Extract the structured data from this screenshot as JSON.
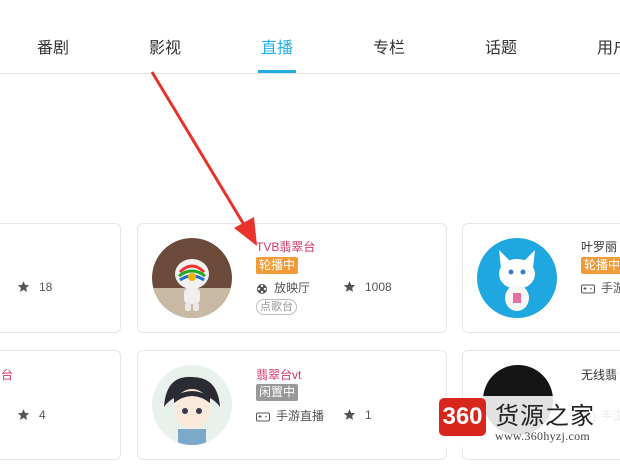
{
  "tabs": [
    "番剧",
    "影视",
    "直播",
    "专栏",
    "话题",
    "用户"
  ],
  "active_tab": "直播",
  "cards": {
    "r1c1": {
      "count": "18"
    },
    "r1c2": {
      "title": "TVB翡翠台",
      "badge": "轮播中",
      "category": "放映厅",
      "count": "1008",
      "tag": "点歌台"
    },
    "r1c3": {
      "title": "叶罗丽",
      "badge": "轮播中",
      "category": "手游"
    },
    "r2c1": {
      "title": "台",
      "count": "4"
    },
    "r2c2": {
      "title": "翡翠台vt",
      "badge": "闲置中",
      "category": "手游直播",
      "count": "1"
    },
    "r2c3": {
      "title": "无线翡",
      "category": "手游"
    }
  },
  "watermark": {
    "logo": "360",
    "name": "货源之家",
    "url": "www.360hyzj.com"
  },
  "colors": {
    "accent": "#23ade5",
    "title_pink": "#d23669",
    "live_orange": "#f19c38",
    "idle_gray": "#999999",
    "arrow_red": "#e8322b"
  },
  "icons": [
    "film-reel-icon",
    "gamepad-icon",
    "star-icon",
    "arrow-annotation"
  ]
}
